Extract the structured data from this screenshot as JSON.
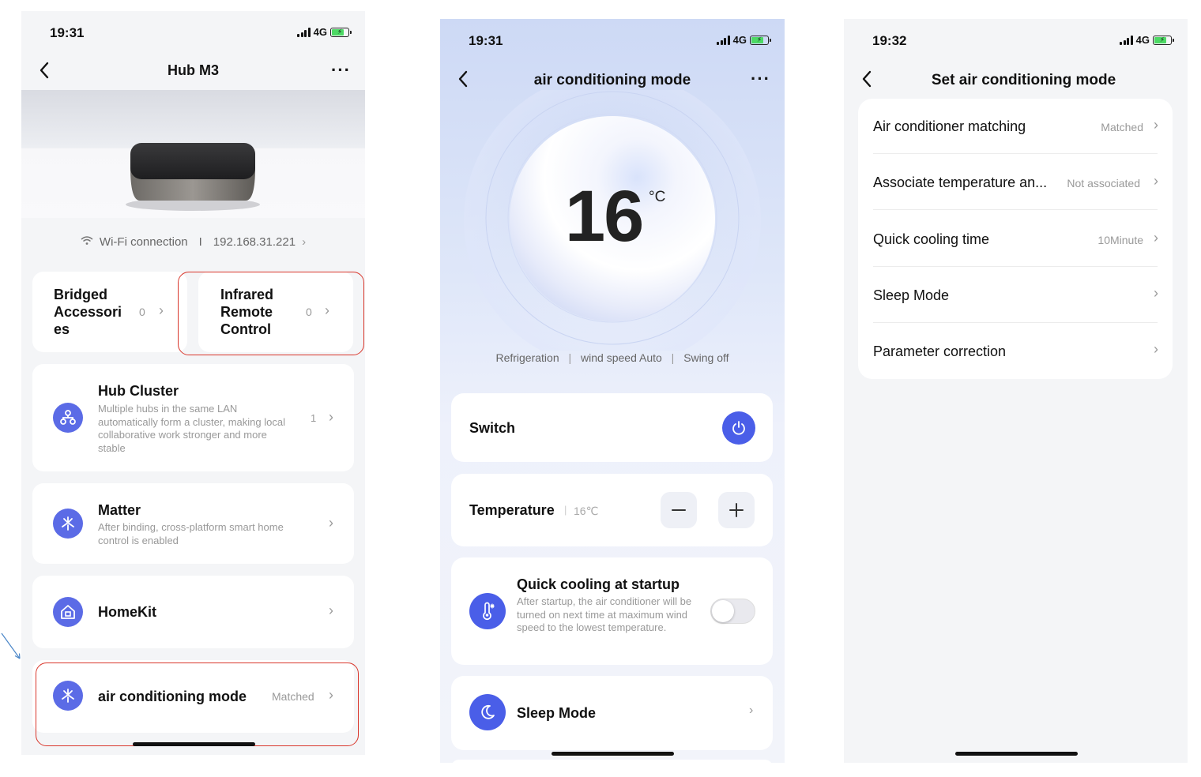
{
  "screen1": {
    "time": "19:31",
    "network": "4G",
    "title": "Hub M3",
    "more": "···",
    "connection": "Wi-Fi connection",
    "separator": "I",
    "ip": "192.168.31.221",
    "bridged": {
      "label": "Bridged Accessori es",
      "count": "0"
    },
    "infrared": {
      "label": "Infrared Remote Control",
      "count": "0"
    },
    "cluster": {
      "title": "Hub Cluster",
      "desc": "Multiple hubs in the same LAN automatically form a cluster, making local collaborative work stronger and more stable",
      "count": "1"
    },
    "matter": {
      "title": "Matter",
      "desc": "After binding, cross-platform smart home control is enabled"
    },
    "homekit": {
      "title": "HomeKit"
    },
    "ac_mode": {
      "title": "air conditioning mode",
      "status": "Matched"
    }
  },
  "screen2": {
    "time": "19:31",
    "network": "4G",
    "title": "air conditioning mode",
    "more": "···",
    "temp_value": "16",
    "temp_unit": "°C",
    "mode_refrig": "Refrigeration",
    "mode_wind": "wind speed Auto",
    "mode_swing": "Swing off",
    "switch_label": "Switch",
    "temperature_label": "Temperature",
    "temperature_value": "16℃",
    "quick_cool_title": "Quick cooling at startup",
    "quick_cool_desc": "After startup, the air conditioner will be turned on next time at maximum wind speed to the lowest temperature.",
    "sleep_label": "Sleep Mode"
  },
  "screen3": {
    "time": "19:32",
    "network": "4G",
    "title": "Set air conditioning mode",
    "items": [
      {
        "label": "Air conditioner matching",
        "value": "Matched"
      },
      {
        "label": "Associate temperature an...",
        "value": "Not associated"
      },
      {
        "label": "Quick cooling time",
        "value": "10Minute"
      },
      {
        "label": "Sleep Mode",
        "value": ""
      },
      {
        "label": "Parameter correction",
        "value": ""
      }
    ]
  },
  "colors": {
    "accent": "#5b6be6",
    "highlight_border": "#d9362b",
    "arrow": "#4a86c8"
  }
}
